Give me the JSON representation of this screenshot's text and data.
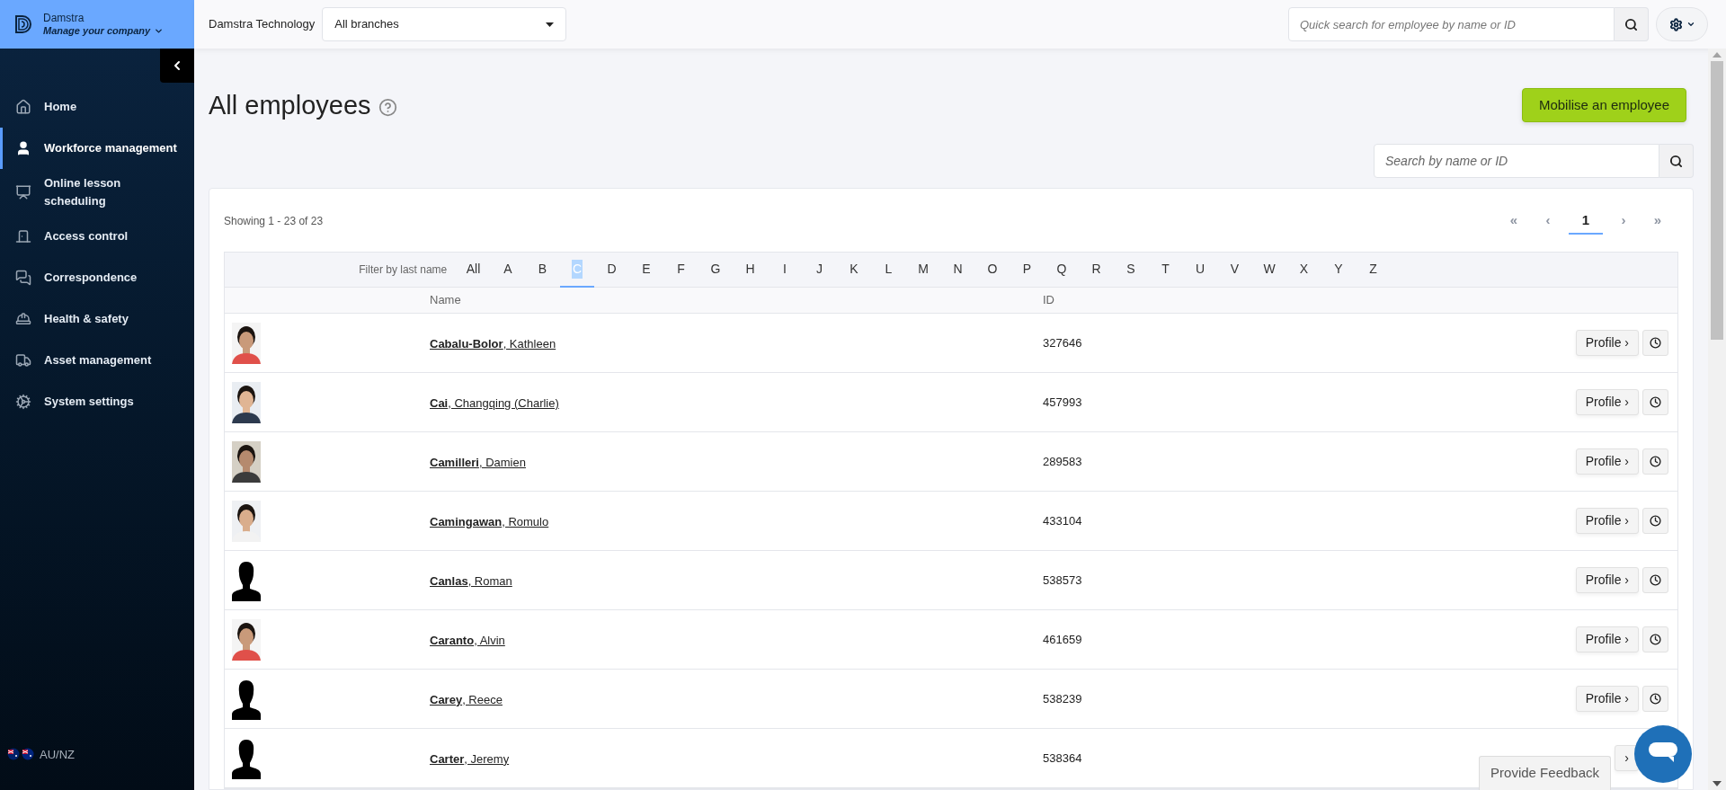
{
  "sidebar": {
    "company": "Damstra",
    "subtitle": "Manage your company",
    "items": [
      {
        "label": "Home",
        "selected": false
      },
      {
        "label": "Workforce management",
        "selected": true
      },
      {
        "label": "Online lesson scheduling",
        "selected": false
      },
      {
        "label": "Access control",
        "selected": false
      },
      {
        "label": "Correspondence",
        "selected": false
      },
      {
        "label": "Health & safety",
        "selected": false
      },
      {
        "label": "Asset management",
        "selected": false
      },
      {
        "label": "System settings",
        "selected": false
      }
    ],
    "region": "AU/NZ"
  },
  "topbar": {
    "organisation": "Damstra Technology",
    "branch_select": {
      "value": "All branches"
    },
    "quick_search": {
      "placeholder": "Quick search for employee by name or ID"
    }
  },
  "page": {
    "title": "All employees",
    "primary_button": "Mobilise an employee",
    "search": {
      "placeholder": "Search by name or ID"
    },
    "showing": "Showing 1 - 23 of 23",
    "pagination": [
      {
        "label": "«",
        "selected": false,
        "disabled": true
      },
      {
        "label": "‹",
        "selected": false,
        "disabled": true
      },
      {
        "label": "1",
        "selected": true,
        "disabled": false
      },
      {
        "label": "›",
        "selected": false,
        "disabled": true
      },
      {
        "label": "»",
        "selected": false,
        "disabled": true
      }
    ],
    "filter": {
      "label": "Filter by last name",
      "letters": [
        {
          "label": "All",
          "selected": false
        },
        {
          "label": "A",
          "selected": false
        },
        {
          "label": "B",
          "selected": false
        },
        {
          "label": "C",
          "selected": true
        },
        {
          "label": "D",
          "selected": false
        },
        {
          "label": "E",
          "selected": false
        },
        {
          "label": "F",
          "selected": false
        },
        {
          "label": "G",
          "selected": false
        },
        {
          "label": "H",
          "selected": false
        },
        {
          "label": "I",
          "selected": false
        },
        {
          "label": "J",
          "selected": false
        },
        {
          "label": "K",
          "selected": false
        },
        {
          "label": "L",
          "selected": false
        },
        {
          "label": "M",
          "selected": false
        },
        {
          "label": "N",
          "selected": false
        },
        {
          "label": "O",
          "selected": false
        },
        {
          "label": "P",
          "selected": false
        },
        {
          "label": "Q",
          "selected": false
        },
        {
          "label": "R",
          "selected": false
        },
        {
          "label": "S",
          "selected": false
        },
        {
          "label": "T",
          "selected": false
        },
        {
          "label": "U",
          "selected": false
        },
        {
          "label": "V",
          "selected": false
        },
        {
          "label": "W",
          "selected": false
        },
        {
          "label": "X",
          "selected": false
        },
        {
          "label": "Y",
          "selected": false
        },
        {
          "label": "Z",
          "selected": false
        }
      ]
    },
    "table": {
      "columns": [
        "Name",
        "ID"
      ],
      "rows": [
        {
          "name": "**Cabalu-Bolor**, Kathleen",
          "id": "327646",
          "profile": "Profile ›"
        },
        {
          "name": "**Cai**, Changqing (Charlie)",
          "id": "457993",
          "profile": "Profile ›"
        },
        {
          "name": "**Camilleri**, Damien",
          "id": "289583",
          "profile": "Profile ›"
        },
        {
          "name": "**Camingawan**, Romulo",
          "id": "433104",
          "profile": "Profile ›"
        },
        {
          "photo": {
            "kind": "silhouette"
          },
          "name": "**Canlas**, Roman",
          "id": "538573",
          "profile": "Profile ›"
        },
        {
          "name": "**Caranto**, Alvin",
          "id": "461659",
          "profile": "Profile ›"
        },
        {
          "photo": {
            "kind": "silhouette"
          },
          "name": "**Carey**, Reece",
          "id": "538239",
          "profile": "Profile ›"
        },
        {
          "photo": {
            "kind": "silhouette"
          },
          "name": "**Carter**, Jeremy",
          "id": "538364",
          "profile": "›"
        }
      ]
    }
  },
  "feedback": "Provide Feedback"
}
